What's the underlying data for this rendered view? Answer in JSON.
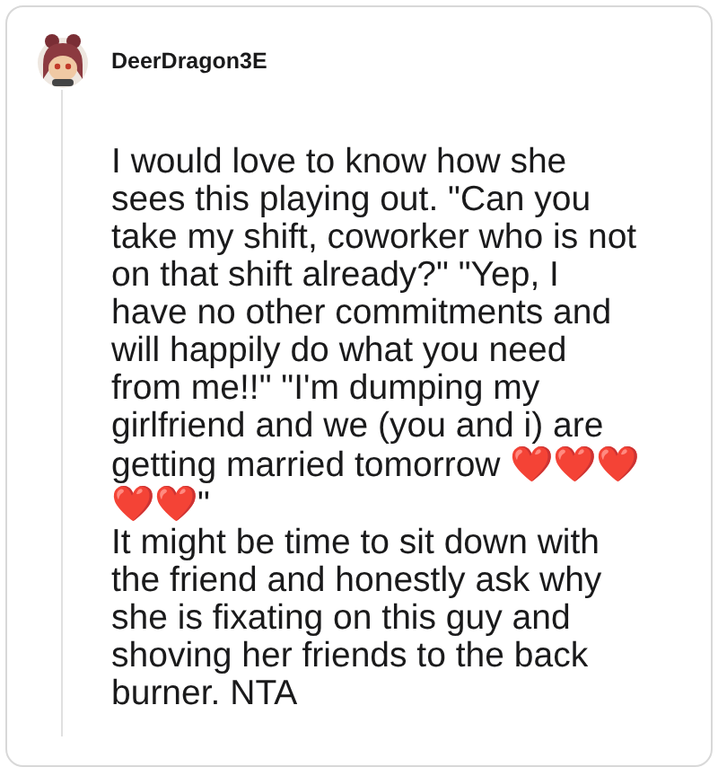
{
  "comment": {
    "username": "DeerDragon3E",
    "paragraphs": [
      [
        {
          "kind": "text",
          "text": "I would love to know how she sees this playing out. \"Can you take my shift, coworker who is not on that shift already?\" \"Yep, I have no other commitments and will happily do what you need from me!!\" \"I'm dumping my girlfriend and we (you and i) are getting married tomorrow "
        },
        {
          "kind": "emoji",
          "text": "❤️❤️❤️❤️❤️"
        },
        {
          "kind": "text",
          "text": "\""
        }
      ],
      [
        {
          "kind": "text",
          "text": "It might be time to sit down with the friend and honestly ask why she is fixating on this guy and shoving her friends to the back burner. NTA"
        }
      ]
    ]
  }
}
